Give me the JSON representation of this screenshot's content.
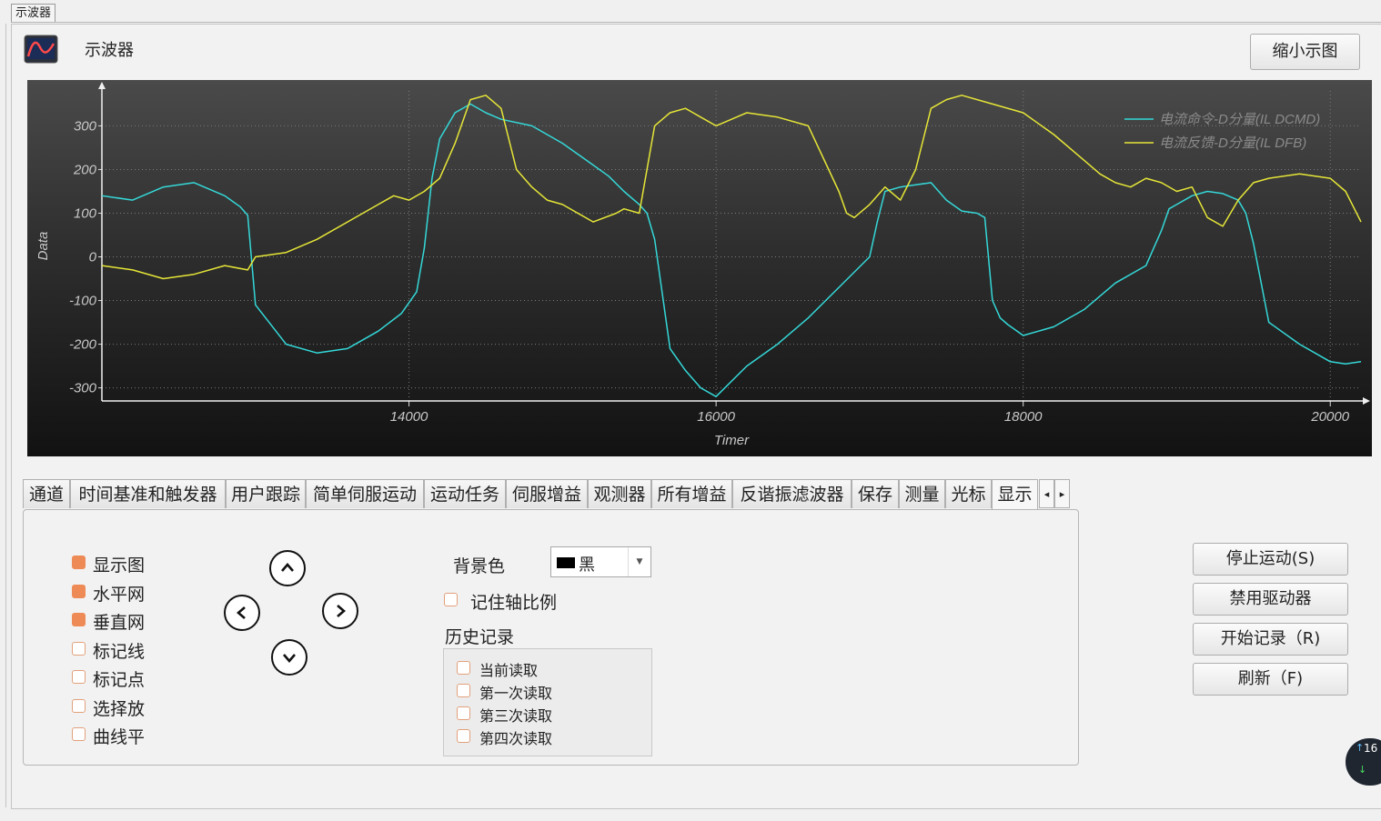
{
  "window": {
    "doc_tab": "示波器",
    "title": "示波器",
    "shrink_button": "缩小示图"
  },
  "tabs": {
    "items": [
      "通道",
      "时间基准和触发器",
      "用户跟踪",
      "简单伺服运动",
      "运动任务",
      "伺服增益",
      "观测器",
      "所有增益",
      "反谐振滤波器",
      "保存",
      "测量",
      "光标",
      "显示"
    ],
    "active": "显示",
    "scroll_left": "◂",
    "scroll_right": "▸"
  },
  "display": {
    "checkboxes": [
      {
        "label": "显示图",
        "checked": true
      },
      {
        "label": "水平网",
        "checked": true
      },
      {
        "label": "垂直网",
        "checked": true
      },
      {
        "label": "标记线",
        "checked": false
      },
      {
        "label": "标记点",
        "checked": false
      },
      {
        "label": "选择放",
        "checked": false
      },
      {
        "label": "曲线平",
        "checked": false
      }
    ],
    "background_label": "背景色",
    "background_value": "黑",
    "remember_axis_label": "记住轴比例",
    "history_title": "历史记录",
    "history": [
      "当前读取",
      "第一次读取",
      "第三次读取",
      "第四次读取"
    ],
    "arrow_icons": [
      "chevron-up-icon",
      "chevron-left-icon",
      "chevron-right-icon",
      "chevron-down-icon"
    ]
  },
  "right_buttons": [
    "停止运动(S)",
    "禁用驱动器",
    "开始记录（R)",
    "刷新（F)"
  ],
  "badge": {
    "value": "16"
  },
  "chart_data": {
    "type": "line",
    "xlabel": "Timer",
    "ylabel": "Data",
    "xlim": [
      12000,
      20200
    ],
    "ylim": [
      -330,
      380
    ],
    "xticks": [
      14000,
      16000,
      18000,
      20000
    ],
    "yticks": [
      300,
      200,
      100,
      0,
      -100,
      -200,
      -300
    ],
    "grid": true,
    "legend_position": "top-right",
    "series": [
      {
        "name": "电流命令-D分量(IL DCMD)",
        "color": "#35d8d8",
        "x": [
          12000,
          12200,
          12400,
          12600,
          12800,
          12900,
          12950,
          13000,
          13200,
          13400,
          13600,
          13800,
          13950,
          14050,
          14100,
          14150,
          14200,
          14300,
          14400,
          14500,
          14600,
          14800,
          15000,
          15200,
          15300,
          15400,
          15500,
          15550,
          15600,
          15700,
          15800,
          15900,
          16000,
          16200,
          16400,
          16600,
          16800,
          17000,
          17050,
          17100,
          17200,
          17300,
          17400,
          17500,
          17600,
          17700,
          17750,
          17800,
          17850,
          17900,
          18000,
          18100,
          18200,
          18400,
          18600,
          18800,
          18900,
          18950,
          19000,
          19100,
          19200,
          19300,
          19400,
          19450,
          19500,
          19600,
          19800,
          20000,
          20100,
          20200
        ],
        "values": [
          140,
          130,
          160,
          170,
          140,
          115,
          95,
          -110,
          -200,
          -220,
          -210,
          -170,
          -130,
          -80,
          20,
          180,
          270,
          330,
          350,
          330,
          315,
          300,
          260,
          210,
          185,
          150,
          120,
          100,
          40,
          -210,
          -260,
          -300,
          -320,
          -250,
          -200,
          -140,
          -70,
          0,
          80,
          150,
          160,
          165,
          170,
          130,
          105,
          100,
          90,
          -100,
          -140,
          -155,
          -180,
          -170,
          -160,
          -120,
          -60,
          -20,
          60,
          110,
          120,
          140,
          150,
          145,
          130,
          100,
          30,
          -150,
          -200,
          -240,
          -245,
          -240
        ]
      },
      {
        "name": "电流反馈-D分量(IL DFB)",
        "color": "#e6e638",
        "x": [
          12000,
          12200,
          12400,
          12600,
          12800,
          12950,
          13000,
          13200,
          13400,
          13600,
          13800,
          13900,
          14000,
          14100,
          14200,
          14300,
          14400,
          14500,
          14600,
          14700,
          14800,
          14900,
          15000,
          15200,
          15350,
          15400,
          15500,
          15600,
          15700,
          15800,
          15900,
          16000,
          16200,
          16400,
          16600,
          16800,
          16850,
          16900,
          17000,
          17100,
          17200,
          17300,
          17400,
          17500,
          17600,
          17800,
          18000,
          18200,
          18400,
          18500,
          18600,
          18700,
          18800,
          18900,
          19000,
          19100,
          19200,
          19300,
          19400,
          19500,
          19600,
          19800,
          20000,
          20100,
          20200
        ],
        "values": [
          -20,
          -30,
          -50,
          -40,
          -20,
          -30,
          0,
          10,
          40,
          80,
          120,
          140,
          130,
          150,
          180,
          260,
          360,
          370,
          340,
          200,
          160,
          130,
          120,
          80,
          100,
          110,
          100,
          300,
          330,
          340,
          320,
          300,
          330,
          320,
          300,
          150,
          100,
          90,
          120,
          160,
          130,
          200,
          340,
          360,
          370,
          350,
          330,
          280,
          220,
          190,
          170,
          160,
          180,
          170,
          150,
          160,
          90,
          70,
          130,
          170,
          180,
          190,
          180,
          150,
          80
        ]
      }
    ]
  }
}
